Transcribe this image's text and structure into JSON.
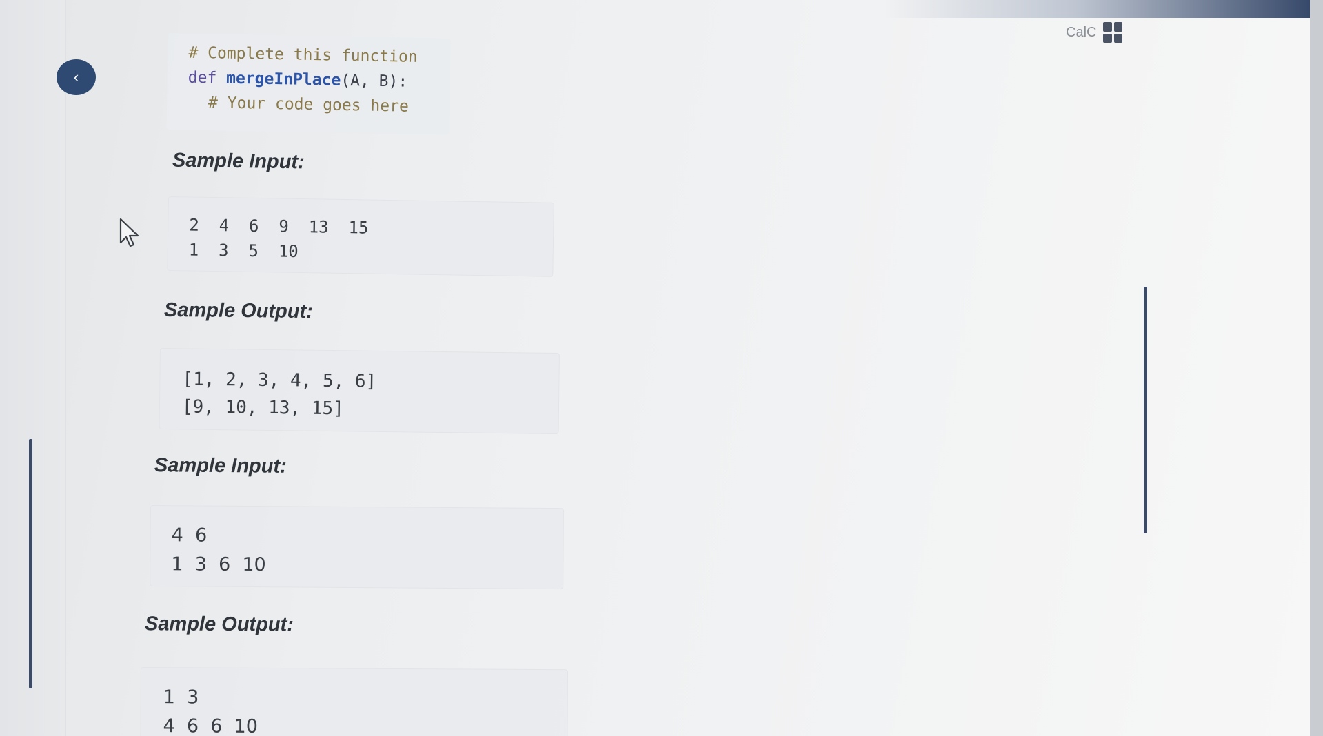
{
  "header": {
    "calc_label": "CalC"
  },
  "code": {
    "line1": "# Complete this function",
    "def_keyword": "def",
    "function_name": "mergeInPlace",
    "params": "(A, B):",
    "line3": "# Your code goes here"
  },
  "samples": [
    {
      "input_label": "Sample Input:",
      "input_lines": [
        "2  4  6  9  13  15",
        "1  3  5  10"
      ],
      "output_label": "Sample Output:",
      "output_lines": [
        "[1, 2, 3, 4, 5, 6]",
        "[9, 10, 13, 15]"
      ]
    },
    {
      "input_label": "Sample Input:",
      "input_lines": [
        "4  6",
        "1  3  6  10"
      ],
      "output_label": "Sample Output:",
      "output_lines": [
        "1  3",
        "4  6  6  10"
      ]
    }
  ],
  "icons": {
    "back": "chevron-left-icon",
    "calc": "calculator-grid-icon",
    "cursor": "mouse-pointer-icon"
  },
  "colors": {
    "accent": "#2f4a72",
    "rule": "#3c4a66"
  }
}
